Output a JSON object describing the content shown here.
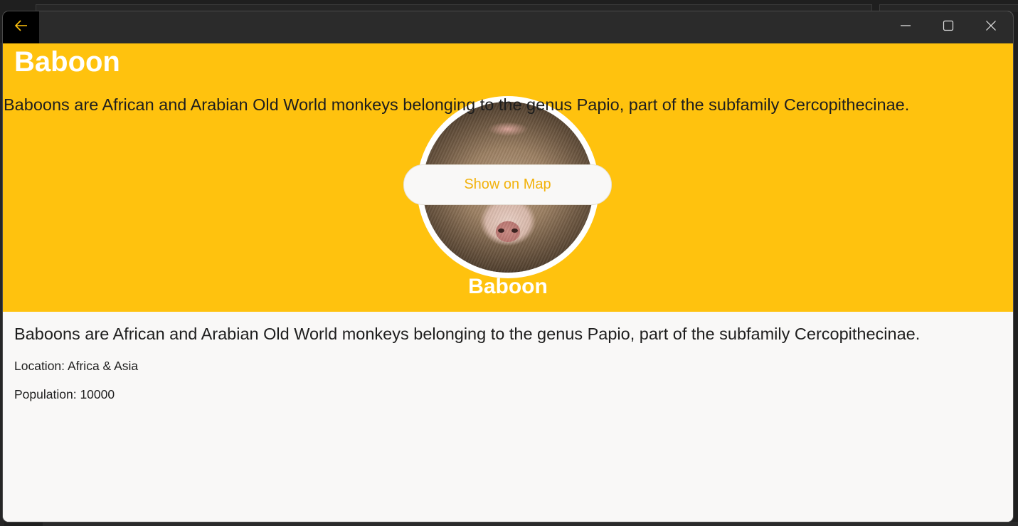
{
  "window": {
    "back_icon": "arrow-left-icon",
    "minimize_icon": "minimize-icon",
    "maximize_icon": "maximize-icon",
    "close_icon": "close-icon"
  },
  "header": {
    "title": "Baboon",
    "description": "Baboons are African and Arabian Old World monkeys belonging to the genus Papio, part of the subfamily Cercopithecinae.",
    "image_subject": "baboon-face-photo",
    "caption": "Baboon",
    "map_button_label": "Show on Map"
  },
  "details": {
    "description": "Baboons are African and Arabian Old World monkeys belonging to the genus Papio, part of the subfamily Cercopithecinae.",
    "location_label": "Location:",
    "location_value": "Africa & Asia",
    "population_label": "Population:",
    "population_value": "10000"
  },
  "colors": {
    "accent": "#ffc20e",
    "button_text": "#f2b20c",
    "titlebar": "#2b2b2b",
    "content_bg": "#f9f8f7"
  }
}
